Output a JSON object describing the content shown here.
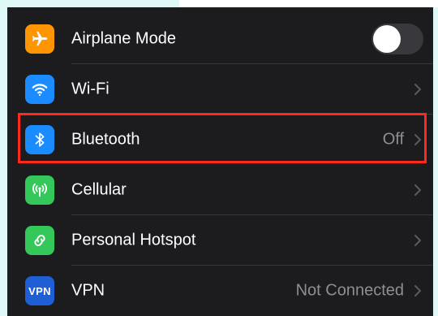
{
  "settings": {
    "rows": [
      {
        "label": "Airplane Mode",
        "icon": "airplane-icon",
        "icon_color": "#ff9500",
        "control": "toggle",
        "toggle_on": false
      },
      {
        "label": "Wi-Fi",
        "icon": "wifi-icon",
        "icon_color": "#1a8cff",
        "value": ""
      },
      {
        "label": "Bluetooth",
        "icon": "bluetooth-icon",
        "icon_color": "#1a8cff",
        "value": "Off"
      },
      {
        "label": "Cellular",
        "icon": "antenna-icon",
        "icon_color": "#34c759",
        "value": ""
      },
      {
        "label": "Personal Hotspot",
        "icon": "link-icon",
        "icon_color": "#34c759",
        "value": ""
      },
      {
        "label": "VPN",
        "icon": "vpn-icon",
        "icon_color": "#1f5fd6",
        "icon_text": "VPN",
        "value": "Not Connected"
      }
    ]
  },
  "highlight": {
    "target": "Bluetooth",
    "color": "#ff2a1b"
  },
  "colors": {
    "background": "#1c1c1e",
    "text": "#ffffff",
    "secondary_text": "#8e8e93",
    "separator": "#38383a"
  }
}
